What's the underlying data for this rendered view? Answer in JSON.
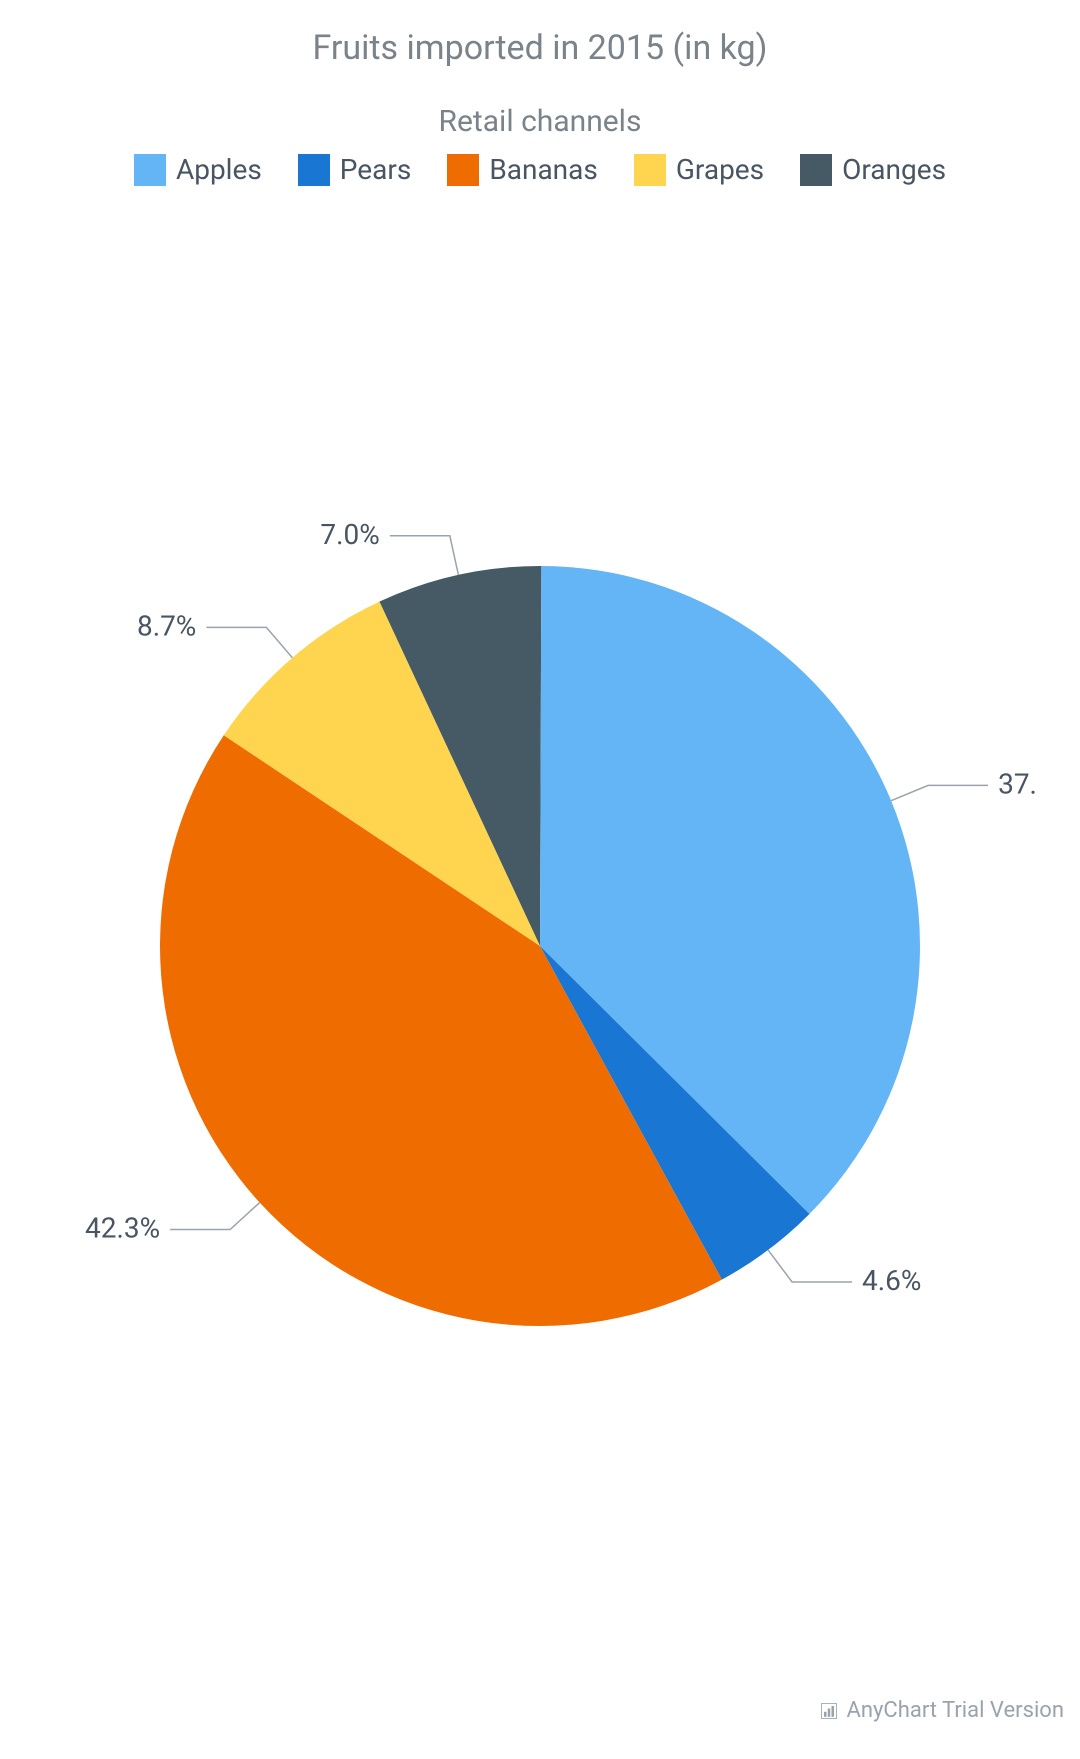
{
  "title": "Fruits imported in 2015 (in kg)",
  "legend_title": "Retail channels",
  "footer": "AnyChart Trial Version",
  "chart_data": {
    "type": "pie",
    "title": "Fruits imported in 2015 (in kg)",
    "legend_title": "Retail channels",
    "categories": [
      "Apples",
      "Pears",
      "Bananas",
      "Grapes",
      "Oranges"
    ],
    "values": [
      37.4,
      4.6,
      42.3,
      8.7,
      7.0
    ],
    "labels": [
      "37.",
      "4.6%",
      "42.3%",
      "8.7%",
      "7.0%"
    ],
    "colors": [
      "#64b5f6",
      "#1976d2",
      "#ef6c00",
      "#ffd54f",
      "#455a64"
    ],
    "legend_position": "top"
  }
}
